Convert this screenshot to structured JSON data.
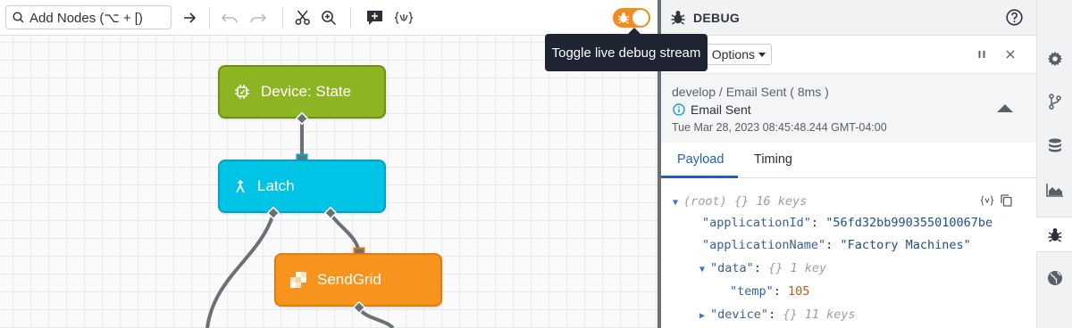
{
  "toolbar": {
    "search_label": "Add Nodes (⌥ + [)",
    "toggle_state": "on",
    "toggle_color": "#f58a1f"
  },
  "tooltip": {
    "text": "Toggle live debug stream"
  },
  "nodes": [
    {
      "label": "Device: State",
      "color": "#8db523",
      "icon": "device-state-icon"
    },
    {
      "label": "Latch",
      "color": "#00c4e6",
      "icon": "latch-icon"
    },
    {
      "label": "SendGrid",
      "color": "#f7941d",
      "icon": "sendgrid-icon"
    }
  ],
  "debug": {
    "title": "DEBUG",
    "options_label": "Options",
    "entry": {
      "path": "develop / Email Sent ( 8ms )",
      "name": "Email Sent",
      "timestamp": "Tue Mar 28, 2023 08:45:48.244 GMT-04:00"
    },
    "tabs": [
      {
        "label": "Payload",
        "active": true
      },
      {
        "label": "Timing",
        "active": false
      }
    ],
    "tree": {
      "root_label": "(root)",
      "root_meta": "{} 16 keys",
      "application_id_key": "\"applicationId\"",
      "application_id_value": "\"56fd32bb990355010067be",
      "application_name_key": "\"applicationName\"",
      "application_name_value": "\"Factory Machines\"",
      "data_key": "\"data\"",
      "data_meta": "{} 1 key",
      "temp_key": "\"temp\"",
      "temp_value": "105",
      "device_key": "\"device\"",
      "device_meta": "{} 11 keys"
    }
  },
  "rail": {
    "items": [
      {
        "icon": "gear-icon",
        "active": false
      },
      {
        "icon": "branch-icon",
        "active": false
      },
      {
        "icon": "database-icon",
        "active": false
      },
      {
        "icon": "area-chart-icon",
        "active": false
      },
      {
        "icon": "bug-icon",
        "active": true
      },
      {
        "icon": "globe-icon",
        "active": false
      }
    ]
  }
}
